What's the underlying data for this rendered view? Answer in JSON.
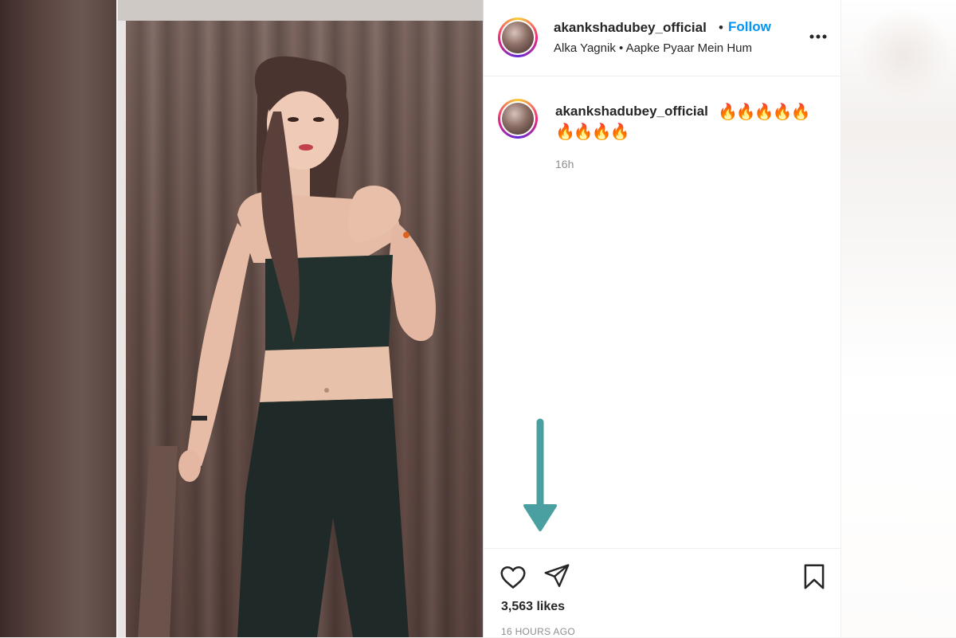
{
  "post": {
    "username": "akankshadubey_official",
    "separator": "•",
    "follow_label": "Follow",
    "audio": "Alka Yagnik • Aapke Pyaar Mein Hum",
    "more_icon": "more-horizontal-icon"
  },
  "caption": {
    "username": "akankshadubey_official",
    "emoji_line1": "🔥🔥🔥🔥🔥",
    "emoji_line2": "🔥🔥🔥🔥",
    "time": "16h"
  },
  "actions": {
    "like_icon": "heart-icon",
    "share_icon": "paper-plane-icon",
    "save_icon": "bookmark-icon",
    "likes": "3,563 likes",
    "timestamp": "16 HOURS AGO"
  },
  "media": {
    "mute_icon": "speaker-muted-icon"
  },
  "colors": {
    "accent_blue": "#0095f6",
    "annotation_arrow": "#4aa0a0",
    "text_primary": "#262626",
    "text_secondary": "#8e8e8e"
  }
}
